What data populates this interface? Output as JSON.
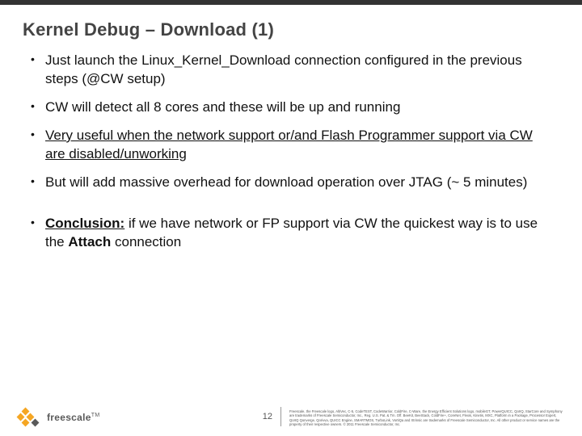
{
  "brandColors": {
    "accent": "#f5a623",
    "text": "#444444"
  },
  "slide": {
    "title": "Kernel Debug – Download (1)",
    "bullets": [
      {
        "pre": "Just launch the Linux_Kernel_Download connection configured in the previous steps (@CW setup)"
      },
      {
        "pre": "CW will detect all 8 cores and these will be up and running"
      },
      {
        "pre": "",
        "underline": "Very useful when the network support or/and Flash Programmer support via CW are disabled/unworking"
      },
      {
        "pre": "But will add massive overhead for download operation over JTAG (~ 5 minutes)"
      },
      {
        "boldUnderline": "Conclusion:",
        "mid": " if we have network or FP support via CW the quickest way is to use the ",
        "bold": "Attach",
        "post": " connection",
        "gap": true
      }
    ]
  },
  "footer": {
    "logoText": "freescale",
    "tm": "TM",
    "pageNumber": "12",
    "legal": "Freescale, the Freescale logo, AltiVec, C-5, CodeTEST, CodeWarrior, ColdFire, C-Ware, the Energy Efficient Solutions logo, mobileGT, PowerQUICC, QorIQ, StarCore and Symphony are trademarks of Freescale Semiconductor, Inc., Reg. U.S. Pat. & Tm. Off. BeeKit, BeeStack, ColdFire+, CoreNet, Flexis, Kinetis, MXC, Platform in a Package, Processor Expert, QorIQ Qonverge, Qorivva, QUICC Engine, SMARTMOS, TurboLink, VortiQa and Xtrinsic are trademarks of Freescale Semiconductor, Inc. All other product or service names are the property of their respective owners. © 2011 Freescale Semiconductor, Inc."
  }
}
